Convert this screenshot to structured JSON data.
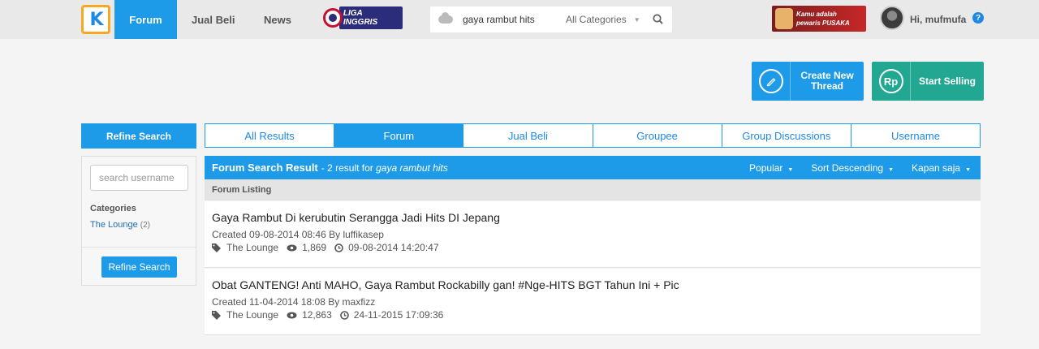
{
  "header": {
    "logo_text": "K",
    "nav": [
      "Forum",
      "Jual Beli",
      "News"
    ],
    "liga_label": "LIGA INGGRIS",
    "search": {
      "value": "gaya rambut hits",
      "category": "All Categories"
    },
    "promo_line1": "Kamu adalah",
    "promo_line2": "pewaris PUSAKA",
    "greeting": "Hi, mufmufa",
    "help": "?"
  },
  "actions": {
    "create_thread": "Create New Thread",
    "start_selling": "Start Selling",
    "rp_icon": "Rp"
  },
  "sidebar": {
    "title": "Refine Search",
    "username_placeholder": "search username",
    "categories_title": "Categories",
    "category": {
      "name": "The Lounge",
      "count": "(2)"
    },
    "button": "Refine Search"
  },
  "tabs": [
    "All Results",
    "Forum",
    "Jual Beli",
    "Groupee",
    "Group Discussions",
    "Username"
  ],
  "results": {
    "title": "Forum Search Result",
    "summary_prefix": "- 2 result for ",
    "query": "gaya rambut hits",
    "sort": [
      "Popular",
      "Sort Descending",
      "Kapan saja"
    ],
    "listing_label": "Forum Listing",
    "threads": [
      {
        "title": "Gaya Rambut Di kerubutin Serangga Jadi Hits DI Jepang",
        "created": "Created 09-08-2014 08:46 By luffikasep",
        "category": "The Lounge",
        "views": "1,869",
        "last_post": "09-08-2014 14:20:47"
      },
      {
        "title": "Obat GANTENG! Anti MAHO, Gaya Rambut Rockabilly gan! #Nge-HITS BGT Tahun Ini + Pic",
        "created": "Created 11-04-2014 18:08 By maxfizz",
        "category": "The Lounge",
        "views": "12,863",
        "last_post": "24-11-2015 17:09:36"
      }
    ]
  },
  "colors": {
    "primary": "#1e9be8",
    "sell": "#22a892",
    "logo_border": "#f7a823"
  }
}
